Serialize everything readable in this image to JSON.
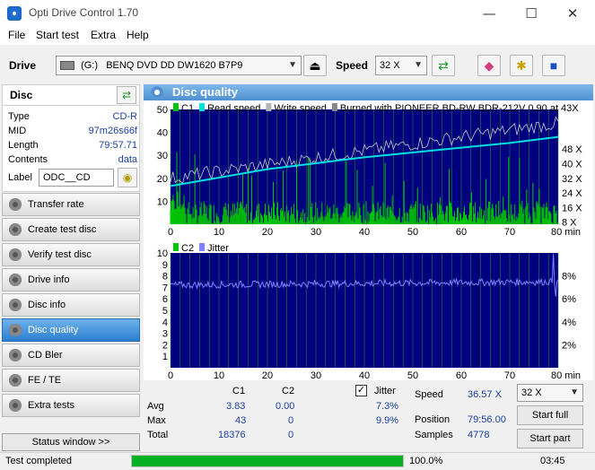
{
  "window": {
    "title": "Opti Drive Control 1.70",
    "minimize": "—",
    "maximize": "☐",
    "close": "✕"
  },
  "menu": [
    "File",
    "Start test",
    "Extra",
    "Help"
  ],
  "drive": {
    "label": "Drive",
    "letter": "(G:)",
    "name": "BENQ DVD DD DW1620 B7P9",
    "speed_label": "Speed",
    "speed": "32 X"
  },
  "disc": {
    "header": "Disc",
    "rows": [
      {
        "k": "Type",
        "v": "CD-R"
      },
      {
        "k": "MID",
        "v": "97m26s66f"
      },
      {
        "k": "Length",
        "v": "79:57.71"
      },
      {
        "k": "Contents",
        "v": "data"
      }
    ],
    "label_key": "Label",
    "label_value": "ODC__CD"
  },
  "nav": [
    "Transfer rate",
    "Create test disc",
    "Verify test disc",
    "Drive info",
    "Disc info",
    "Disc quality",
    "CD Bler",
    "FE / TE",
    "Extra tests"
  ],
  "nav_active": 5,
  "status_window": "Status window >>",
  "main": {
    "title": "Disc quality"
  },
  "chart_data": [
    {
      "type": "line",
      "legend": [
        "C1",
        "Read speed",
        "Write speed",
        "Burned with PIONEER BD-RW   BDR-212V 0.90 at 43X"
      ],
      "x_ticks": [
        "0",
        "10",
        "20",
        "30",
        "40",
        "50",
        "60",
        "70",
        "80 min"
      ],
      "y_ticks": [
        "10",
        "20",
        "30",
        "40",
        "50"
      ],
      "y2_ticks": [
        "8 X",
        "16 X",
        "24 X",
        "32 X",
        "40 X",
        "48 X"
      ],
      "xlim": [
        0,
        80
      ],
      "ylim": [
        0,
        50
      ],
      "y2lim": [
        0,
        48
      ],
      "series": [
        {
          "name": "C1",
          "color": "#00c800",
          "note": "bars avg 3.83 max 43"
        },
        {
          "name": "Read speed",
          "color": "#00e0e0",
          "x": [
            0,
            10,
            20,
            30,
            40,
            50,
            60,
            70,
            80
          ],
          "y": [
            16,
            19.5,
            23,
            25.5,
            28,
            30,
            32,
            34,
            36.5
          ]
        },
        {
          "name": "Write speed",
          "color": "#b4b4b4",
          "x": [
            0,
            80
          ],
          "y": [
            43,
            43
          ]
        }
      ]
    },
    {
      "type": "line",
      "legend": [
        "C2",
        "Jitter"
      ],
      "x_ticks": [
        "0",
        "10",
        "20",
        "30",
        "40",
        "50",
        "60",
        "70",
        "80 min"
      ],
      "y_ticks": [
        "1",
        "2",
        "3",
        "4",
        "5",
        "6",
        "7",
        "8",
        "9",
        "10"
      ],
      "y2_ticks": [
        "2%",
        "4%",
        "6%",
        "8%"
      ],
      "xlim": [
        0,
        80
      ],
      "ylim": [
        0,
        10
      ],
      "y2lim": [
        0,
        10
      ],
      "series": [
        {
          "name": "Jitter",
          "color": "#8080ff",
          "x": [
            0,
            10,
            20,
            30,
            40,
            50,
            60,
            70,
            78,
            79,
            80
          ],
          "y": [
            7.2,
            7.2,
            7.3,
            7.6,
            7.4,
            7.3,
            7.5,
            7.3,
            7.4,
            9.9,
            7.3
          ]
        }
      ]
    }
  ],
  "stats": {
    "c1_h": "C1",
    "c2_h": "C2",
    "jitter_h": "Jitter",
    "avg_l": "Avg",
    "max_l": "Max",
    "total_l": "Total",
    "avg_c1": "3.83",
    "avg_c2": "0.00",
    "avg_j": "7.3%",
    "max_c1": "43",
    "max_c2": "0",
    "max_j": "9.9%",
    "tot_c1": "18376",
    "tot_c2": "0",
    "speed_l": "Speed",
    "speed_v": "36.57 X",
    "pos_l": "Position",
    "pos_v": "79:56.00",
    "samp_l": "Samples",
    "samp_v": "4778",
    "speed_sel": "32 X",
    "start_full": "Start full",
    "start_part": "Start part"
  },
  "statusbar": {
    "text": "Test completed",
    "progress": "100.0%",
    "progress_value": 1.0,
    "time": "03:45"
  }
}
